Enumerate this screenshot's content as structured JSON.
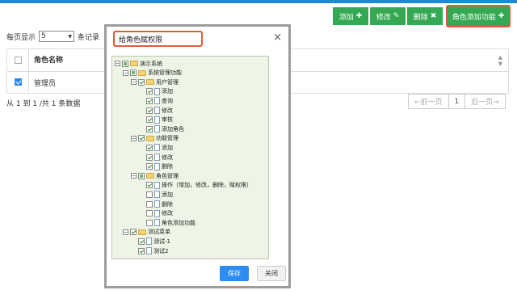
{
  "toolbar": {
    "add": "添加",
    "edit": "修改",
    "delete": "删除",
    "role_add_function": "角色添加功能"
  },
  "page_size": {
    "label": "每页显示",
    "value": "5",
    "suffix": "条记录"
  },
  "table": {
    "header": "角色名称",
    "rows": [
      {
        "name": "管理员",
        "checked": true
      }
    ]
  },
  "pagination": {
    "info": "从 1 到 1 /共 1 条数据",
    "prev": "←前一页",
    "current": "1",
    "next": "后一页→"
  },
  "modal": {
    "title": "给角色赋权限",
    "save": "保存",
    "close": "关闭",
    "tree": [
      {
        "label": "演示系统",
        "checked": "part"
      },
      {
        "label": "系统管理功能",
        "checked": "part"
      },
      {
        "label": "用户管理",
        "checked": "on"
      },
      {
        "label": "添加",
        "checked": "on"
      },
      {
        "label": "查询",
        "checked": "on"
      },
      {
        "label": "修改",
        "checked": "on"
      },
      {
        "label": "审核",
        "checked": "on"
      },
      {
        "label": "添加角色",
        "checked": "on"
      },
      {
        "label": "功能管理",
        "checked": "on"
      },
      {
        "label": "添加",
        "checked": "on"
      },
      {
        "label": "修改",
        "checked": "on"
      },
      {
        "label": "删除",
        "checked": "on"
      },
      {
        "label": "角色管理",
        "checked": "part"
      },
      {
        "label": "操作（增加，修改，删除，赋权限）",
        "checked": "on"
      },
      {
        "label": "添加",
        "checked": "off"
      },
      {
        "label": "删除",
        "checked": "off"
      },
      {
        "label": "修改",
        "checked": "off"
      },
      {
        "label": "角色添加功能",
        "checked": "off"
      },
      {
        "label": "测试菜单",
        "checked": "on"
      },
      {
        "label": "测试-1",
        "checked": "on"
      },
      {
        "label": "测试2",
        "checked": "on"
      }
    ]
  },
  "colors": {
    "green": "#35a853",
    "blue": "#2d8cf0",
    "highlight": "#e35b3d"
  }
}
